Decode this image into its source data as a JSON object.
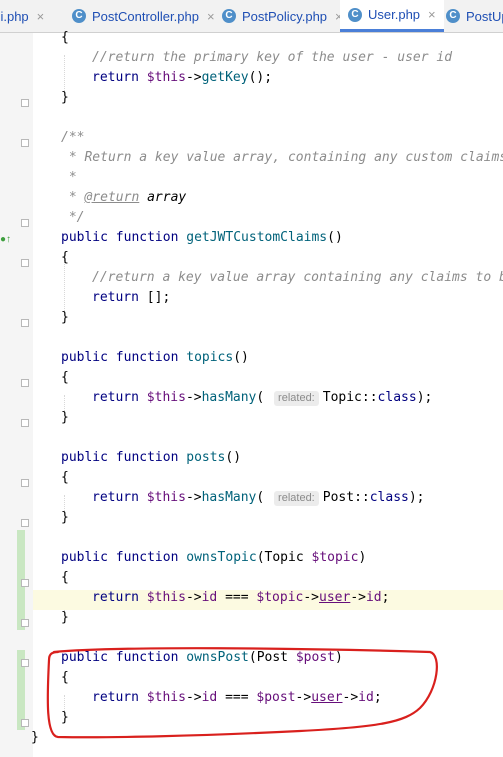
{
  "tabs": [
    {
      "label": "api.php",
      "icon": "php-file-icon",
      "active": false
    },
    {
      "label": "PostController.php",
      "icon": "php-class-icon",
      "active": false
    },
    {
      "label": "PostPolicy.php",
      "icon": "php-class-icon",
      "active": false
    },
    {
      "label": "User.php",
      "icon": "php-class-icon",
      "active": true
    },
    {
      "label": "PostUp",
      "icon": "php-class-icon",
      "active": false
    }
  ],
  "tab_icon_letter": "C",
  "tab_close_glyph": "×",
  "code": {
    "getkey_comment": "//return the primary key of the user - user id",
    "getkey_return": "return ",
    "this": "$this",
    "arrow": "->",
    "getkey_call": "getKey",
    "getkey_tail": "();",
    "doc_open": "/**",
    "doc_line1": " * Return a key value array, containing any custom claims",
    "doc_line2": " *",
    "doc_line3_star": " * ",
    "doc_tag": "@return",
    "doc_type": " array",
    "doc_close": " */",
    "public": "public ",
    "function": "function ",
    "fn_claims": "getJWTCustomClaims",
    "parens": "()",
    "claims_comment": "//return a key value array containing any claims to be",
    "return_empty": "[];",
    "fn_topics": "topics",
    "fn_posts": "posts",
    "has_many": "hasMany",
    "hint_label": "related:",
    "topic_class": "Topic",
    "post_class": "Post",
    "class_kw": "class",
    "dcolon": "::",
    "fn_owns_topic": "ownsTopic",
    "fn_owns_post": "ownsPost",
    "param_topic": "(Topic ",
    "var_topic": "$topic",
    "param_post": "(Post ",
    "var_post": "$post",
    "id": "id",
    "user": "user",
    "eq": " === ",
    "open_brace": "{",
    "close_brace": "}",
    "semicolon": ";",
    "open_paren": "(",
    "close_paren": ")",
    "close_paren_semi": ");",
    "paren_space": "( ",
    "return_kw": "return ",
    "comma": ","
  },
  "annotation_color": "#d9201d"
}
